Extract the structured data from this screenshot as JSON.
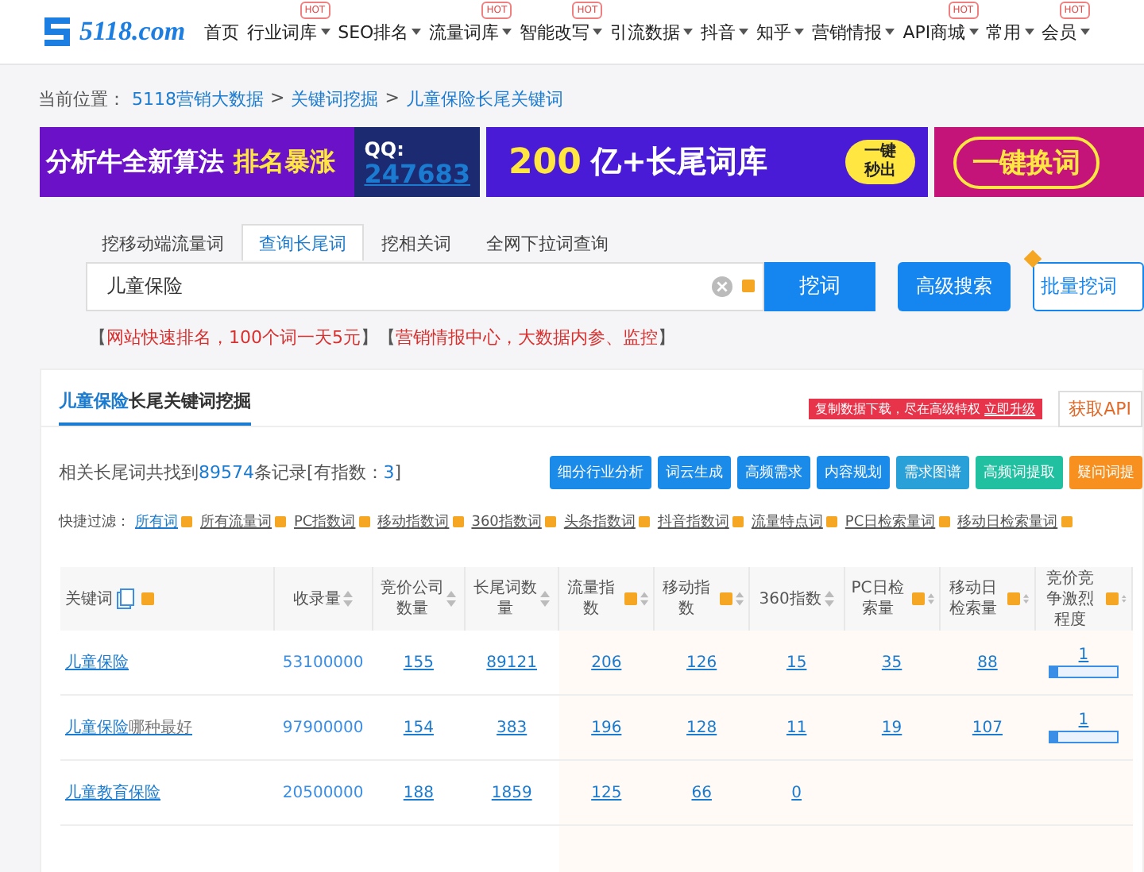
{
  "header": {
    "logo": "5118.com",
    "nav": [
      {
        "label": "首页",
        "dropdown": false
      },
      {
        "label": "行业词库",
        "badge": "HOT",
        "dropdown": true
      },
      {
        "label": "SEO排名",
        "dropdown": true
      },
      {
        "label": "流量词库",
        "badge": "HOT",
        "dropdown": true
      },
      {
        "label": "智能改写",
        "badge": "HOT",
        "dropdown": true
      },
      {
        "label": "引流数据",
        "dropdown": true
      },
      {
        "label": "抖音",
        "dropdown": true
      },
      {
        "label": "知乎",
        "dropdown": true
      },
      {
        "label": "营销情报",
        "dropdown": true
      },
      {
        "label": "API商城",
        "badge": "HOT",
        "dropdown": true
      },
      {
        "label": "常用",
        "dropdown": true
      },
      {
        "label": "会员",
        "badge": "HOT",
        "dropdown": true
      }
    ]
  },
  "breadcrumb": {
    "prefix": "当前位置：",
    "links": [
      "5118营销大数据",
      "关键词挖掘",
      "儿童保险长尾关键词"
    ],
    "separators": [
      ">",
      ">"
    ]
  },
  "ads": [
    {
      "kind": "qq",
      "text_1": "分析牛全新算法",
      "text_2": "排名暴涨",
      "text_3": "QQ:",
      "text_4": "247683"
    },
    {
      "kind": "words",
      "text_1": "200",
      "text_2": "亿+长尾词库",
      "text_3": "一键",
      "text_4": "秒出"
    },
    {
      "kind": "swap",
      "text_1": "一键换词"
    }
  ],
  "tabs": [
    {
      "label": "挖移动端流量词",
      "selected": false
    },
    {
      "label": "查询长尾词",
      "selected": true
    },
    {
      "label": "挖相关词",
      "selected": false
    },
    {
      "label": "全网下拉词查询",
      "selected": false
    }
  ],
  "search": {
    "value": "儿童保险",
    "button": "挖词",
    "advanced": "高级搜索",
    "batch": "批量挖词"
  },
  "promo_links": [
    {
      "open": "【",
      "text": "网站快速排名，100个词一天5元",
      "close": "】"
    },
    {
      "open": "【",
      "text": "营销情报中心，大数据内参、监控",
      "close": "】"
    }
  ],
  "panel": {
    "title_highlight": "儿童保险",
    "title_rest": "长尾关键词挖掘",
    "notice": "复制数据下载，尽在高级特权",
    "upgrade": "立即升级",
    "api": "获取API",
    "summary_prefix": "相关长尾词共找到",
    "summary_count": "89574",
    "summary_suffix": "条记录[有指数：",
    "summary_index": "3",
    "summary_end": "]",
    "tools": [
      {
        "label": "细分行业分析",
        "color": "#1a8be8"
      },
      {
        "label": "词云生成",
        "color": "#1a8be8"
      },
      {
        "label": "高频需求",
        "color": "#1a8be8"
      },
      {
        "label": "内容规划",
        "color": "#1a8be8"
      },
      {
        "label": "需求图谱",
        "color": "#2aa0d8"
      },
      {
        "label": "高频词提取",
        "color": "#20c0a0"
      },
      {
        "label": "疑问词提",
        "color": "#f7901e"
      }
    ],
    "filter_label": "快捷过滤：",
    "filters": [
      {
        "label": "所有词",
        "selected": true
      },
      {
        "label": "所有流量词",
        "selected": false
      },
      {
        "label": "PC指数词",
        "selected": false
      },
      {
        "label": "移动指数词",
        "selected": false
      },
      {
        "label": "360指数词",
        "selected": false
      },
      {
        "label": "头条指数词",
        "selected": false
      },
      {
        "label": "抖音指数词",
        "selected": false
      },
      {
        "label": "流量特点词",
        "selected": false
      },
      {
        "label": "PC日检索量词",
        "selected": false
      },
      {
        "label": "移动日检索量词",
        "selected": false
      }
    ]
  },
  "table": {
    "columns": [
      {
        "label": "关键词",
        "help": true,
        "sort": false
      },
      {
        "label": "收录量",
        "help": false,
        "sort": true
      },
      {
        "label": "竞价公司数量",
        "help": false,
        "sort": true
      },
      {
        "label": "长尾词数量",
        "help": false,
        "sort": true
      },
      {
        "label": "流量指数",
        "help": true,
        "sort": true
      },
      {
        "label": "移动指数",
        "help": true,
        "sort": true
      },
      {
        "label": "360指数",
        "help": false,
        "sort": true
      },
      {
        "label": "PC日检索量",
        "help": true,
        "sort": true
      },
      {
        "label": "移动日检索量",
        "help": true,
        "sort": true
      },
      {
        "label": "竞价竞争激烈程度",
        "help": true,
        "sort": true
      }
    ],
    "rows": [
      {
        "cells": [
          {
            "kind": "keyword",
            "text": "儿童保险"
          },
          {
            "kind": "plain",
            "text": "53100000"
          },
          {
            "kind": "link",
            "text": "155"
          },
          {
            "kind": "link",
            "text": "89121"
          },
          {
            "kind": "link",
            "text": "206"
          },
          {
            "kind": "link",
            "text": "126"
          },
          {
            "kind": "link",
            "text": "15"
          },
          {
            "kind": "link",
            "text": "35"
          },
          {
            "kind": "link",
            "text": "88"
          },
          {
            "kind": "meter",
            "text": "1",
            "level": 0.12
          }
        ]
      },
      {
        "cells": [
          {
            "kind": "keyword",
            "text": "儿童保险",
            "rest": "哪种最好"
          },
          {
            "kind": "plain",
            "text": "97900000"
          },
          {
            "kind": "link",
            "text": "154"
          },
          {
            "kind": "link",
            "text": "383"
          },
          {
            "kind": "link",
            "text": "196"
          },
          {
            "kind": "link",
            "text": "128"
          },
          {
            "kind": "link",
            "text": "11"
          },
          {
            "kind": "link",
            "text": "19"
          },
          {
            "kind": "link",
            "text": "107"
          },
          {
            "kind": "meter",
            "text": "1",
            "level": 0.12
          }
        ]
      },
      {
        "cells": [
          {
            "kind": "keyword",
            "text": "儿童教育保险"
          },
          {
            "kind": "plain",
            "text": "20500000"
          },
          {
            "kind": "link",
            "text": "188"
          },
          {
            "kind": "link",
            "text": "1859"
          },
          {
            "kind": "link",
            "text": "125"
          },
          {
            "kind": "link",
            "text": "66"
          },
          {
            "kind": "link",
            "text": "0"
          },
          {
            "kind": "empty"
          },
          {
            "kind": "empty"
          },
          {
            "kind": "empty"
          }
        ]
      }
    ]
  }
}
